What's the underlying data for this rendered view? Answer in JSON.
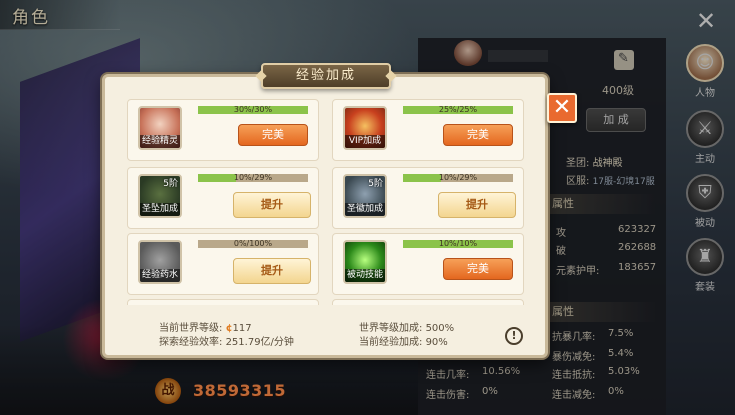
{
  "topbar": {
    "title": "角色",
    "close_glyph": "✕"
  },
  "character": {
    "level": "400级",
    "add_button": "加 成",
    "guild_label": "圣团:",
    "guild_value": "战神殿",
    "zone_label": "区服:",
    "zone_value": "17服-幻境17服",
    "attr_section1": "属性",
    "attr_section2": "属性",
    "stats": [
      {
        "label": "攻",
        "value": "623327"
      },
      {
        "label": "破",
        "value": "262688"
      },
      {
        "label": "元素护甲:",
        "value": "183657"
      }
    ],
    "stats2": [
      {
        "label": "抗暴几率:",
        "value": "7.5%"
      },
      {
        "label": "暴伤减免:",
        "value": "5.4%"
      },
      {
        "label": "连击几率:",
        "value": "10.56%"
      },
      {
        "label": "连击抵抗:",
        "value": "5.03%"
      },
      {
        "label": "连击伤害:",
        "value": "0%"
      },
      {
        "label": "连击减免:",
        "value": "0%"
      }
    ],
    "power_emblem": "战",
    "power_value": "38593315"
  },
  "sidenav": [
    {
      "label": "人物",
      "glyph": "☺",
      "active": true
    },
    {
      "label": "主动",
      "glyph": "⚔",
      "active": false
    },
    {
      "label": "被动",
      "glyph": "⛨",
      "active": false
    },
    {
      "label": "套装",
      "glyph": "♜",
      "active": false
    }
  ],
  "modal": {
    "title": "经验加成",
    "close_glyph": "✕",
    "cards": [
      {
        "name": "经验精灵",
        "icon": "elf-icon",
        "badge": "",
        "progress_text": "30%/30%",
        "progress": 1.0,
        "button": "完美",
        "button_type": "perfect"
      },
      {
        "name": "VIP加成",
        "icon": "vip-icon",
        "badge": "",
        "progress_text": "25%/25%",
        "progress": 1.0,
        "button": "完美",
        "button_type": "perfect"
      },
      {
        "name": "圣坠加成",
        "icon": "holy-icon",
        "badge": "5阶",
        "progress_text": "10%/29%",
        "progress": 0.345,
        "button": "提升",
        "button_type": "upgrade"
      },
      {
        "name": "圣徽加成",
        "icon": "emblem-icon",
        "badge": "5阶",
        "progress_text": "10%/29%",
        "progress": 0.345,
        "button": "提升",
        "button_type": "upgrade"
      },
      {
        "name": "经验药水",
        "icon": "potion-icon",
        "badge": "",
        "progress_text": "0%/100%",
        "progress": 0.0,
        "button": "提升",
        "button_type": "upgrade"
      },
      {
        "name": "被动技能",
        "icon": "passive-icon",
        "badge": "",
        "progress_text": "10%/10%",
        "progress": 1.0,
        "button": "完美",
        "button_type": "perfect"
      }
    ],
    "footer": {
      "world_level_label": "当前世界等级:",
      "world_level_value": "117",
      "world_bonus_label": "世界等级加成:",
      "world_bonus_value": "500%",
      "efficiency_label": "探索经验效率:",
      "efficiency_value": "251.79亿/分钟",
      "current_bonus_label": "当前经验加成:",
      "current_bonus_value": "90%",
      "info_glyph": "!"
    }
  }
}
